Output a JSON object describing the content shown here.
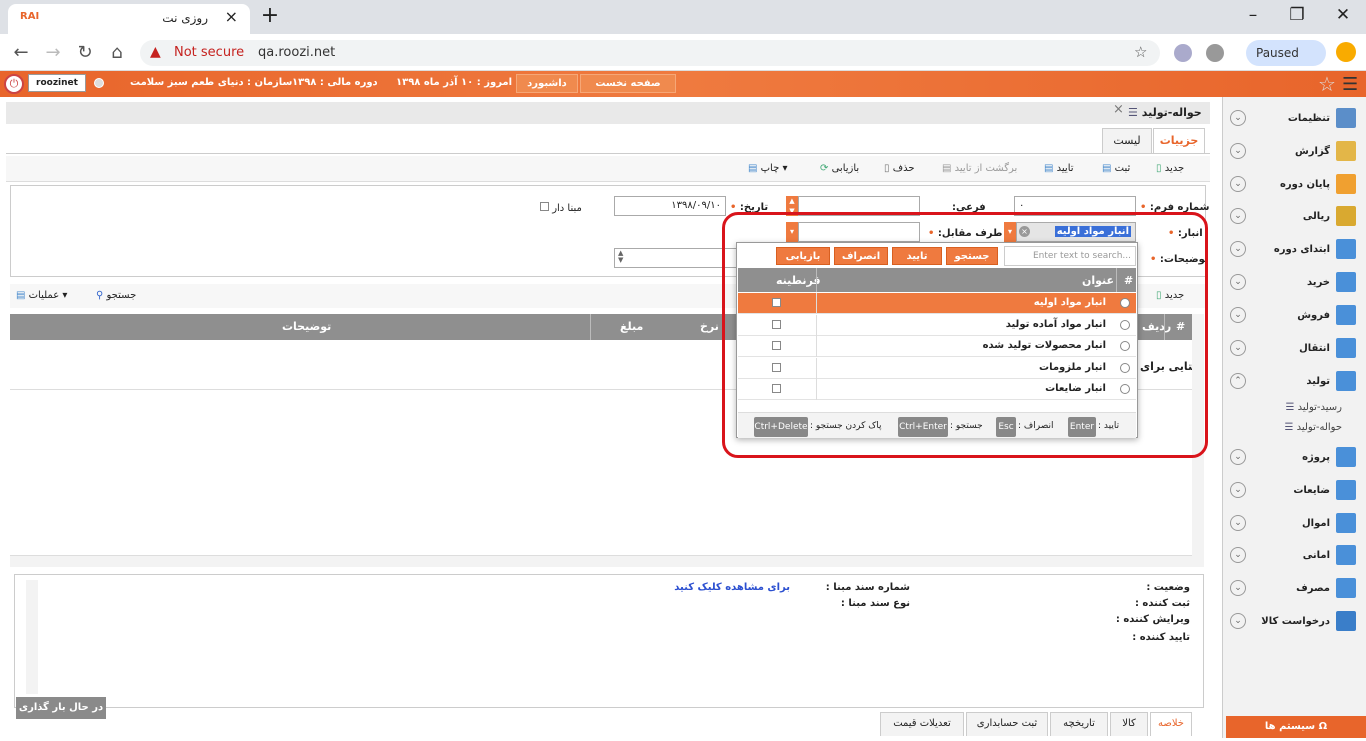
{
  "browser": {
    "tab_title": "روزی نت",
    "logo": "RAI",
    "not_secure": "Not secure",
    "url": "qa.roozi.net",
    "paused": "Paused"
  },
  "header": {
    "brand": "roozinet",
    "home_btn": "صفحه نخست",
    "dashboard_btn": "داشبورد",
    "today": "امروز : ۱۰ آذر ماه ۱۳۹۸",
    "fiscal": "دوره مالی : ۱۳۹۸",
    "org": "سازمان : دنیای طعم سبز سلامت"
  },
  "sidebar": {
    "items": [
      {
        "label": "تنظیمات",
        "color": "#5b8ec9"
      },
      {
        "label": "گزارش",
        "color": "#e3b648"
      },
      {
        "label": "پایان دوره",
        "color": "#f0a030"
      },
      {
        "label": "ریالی",
        "color": "#d9a930"
      },
      {
        "label": "ابتدای دوره",
        "color": "#4a90d9"
      },
      {
        "label": "خرید",
        "color": "#4a90d9"
      },
      {
        "label": "فروش",
        "color": "#4a90d9"
      },
      {
        "label": "انتقال",
        "color": "#4a90d9"
      },
      {
        "label": "تولید",
        "color": "#4a90d9"
      }
    ],
    "sub_items": [
      "رسید-تولید",
      "حواله-تولید"
    ],
    "items2": [
      {
        "label": "پروژه",
        "color": "#4a90d9"
      },
      {
        "label": "ضایعات",
        "color": "#4a90d9"
      },
      {
        "label": "اموال",
        "color": "#4a90d9"
      },
      {
        "label": "امانی",
        "color": "#4a90d9"
      },
      {
        "label": "مصرف",
        "color": "#4a90d9"
      },
      {
        "label": "درخواست کالا",
        "color": "#3a7ec9"
      }
    ],
    "system_btn": "سیستم ها"
  },
  "page": {
    "title": "حواله-تولید",
    "tab_details": "جزییات",
    "tab_list": "لیست"
  },
  "toolbar": {
    "new": "جدید",
    "save": "ثبت",
    "confirm": "تایید",
    "unconfirm": "برگشت از تایید",
    "delete": "حذف",
    "restore": "بازیابی",
    "print": "چاپ"
  },
  "form": {
    "form_no_label": "شماره فرم:",
    "form_no_value": "۰",
    "sub_label": "فرعی:",
    "date_label": "تاریخ:",
    "date_value": "۱۳۹۸/۰۹/۱۰",
    "has_base_label": "مبنا دار",
    "warehouse_label": "انبار:",
    "warehouse_value": "انبار مواد اولیه",
    "party_label": "طرف مقابل:",
    "desc_label": "توضیحات:"
  },
  "detail_toolbar": {
    "new": "جدید",
    "search": "جستجو",
    "ops": "عملیات"
  },
  "grid": {
    "headers": [
      "#",
      "ردیف",
      "نرخ",
      "مبلغ",
      "توضیحات"
    ],
    "empty_text": "دیتایی برای"
  },
  "popup": {
    "search_placeholder": "Enter text to search...",
    "btn_search": "جستجو",
    "btn_confirm": "تایید",
    "btn_cancel": "انصراف",
    "btn_restore": "بازیابی",
    "col_hash": "#",
    "col_title": "عنوان",
    "col_quarantine": "قرنطینه",
    "rows": [
      "انبار مواد اولیه",
      "انبار مواد آماده تولید",
      "انبار محصولات تولید شده",
      "انبار ملزومات",
      "انبار ضایعات"
    ],
    "hint_confirm": "تایید :",
    "key_enter": "Enter",
    "hint_cancel": "انصراف :",
    "key_esc": "Esc",
    "hint_search": "جستجو :",
    "key_ctrl_enter": "Ctrl+Enter",
    "hint_clear": "پاک کردن جستجو :",
    "key_ctrl_delete": "Ctrl+Delete"
  },
  "status": {
    "state": "وضعیت :",
    "registrar": "ثبت کننده :",
    "editor": "ویرایش کننده :",
    "approver": "تایید کننده :",
    "base_doc_no": "شماره سند مبنا :",
    "base_doc_type": "نوع سند مبنا :",
    "view_link": "برای مشاهده کلیک کنید"
  },
  "bottom_tabs": [
    "خلاصه",
    "کالا",
    "تاریخچه",
    "ثبت حسابداری",
    "تعدیلات قیمت"
  ],
  "loading": "در حال بار گذاری ..."
}
